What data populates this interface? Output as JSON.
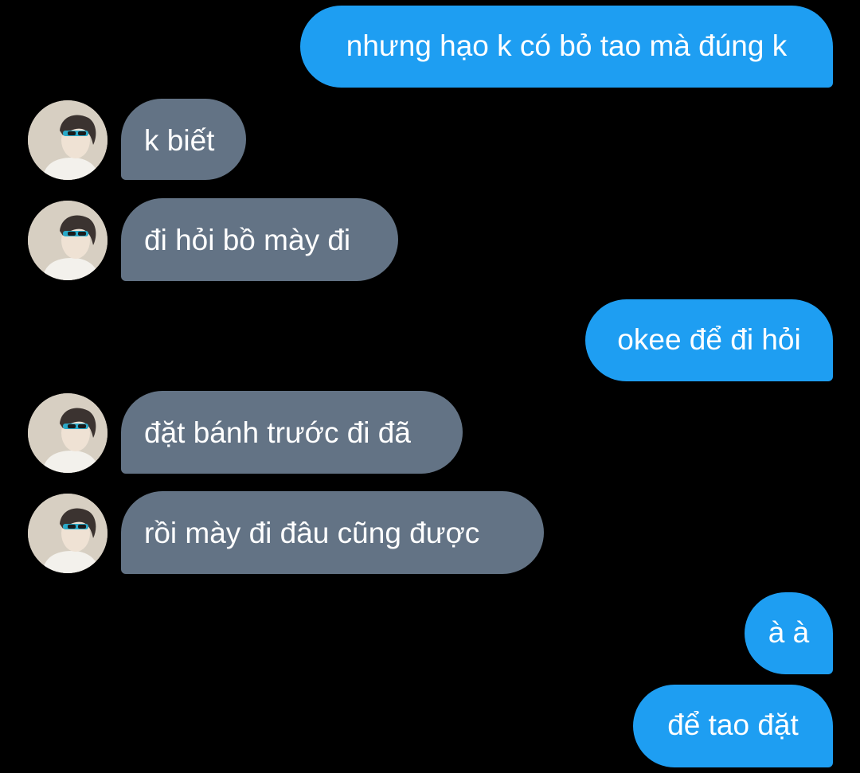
{
  "conversation": {
    "messages": [
      {
        "direction": "outgoing",
        "text": "nhưng hạo k có bỏ tao mà đúng k"
      },
      {
        "direction": "incoming",
        "text": "k biết"
      },
      {
        "direction": "incoming",
        "text": "đi hỏi bồ mày đi"
      },
      {
        "direction": "outgoing",
        "text": "okee để đi hỏi"
      },
      {
        "direction": "incoming",
        "text": "đặt bánh trước đi đã"
      },
      {
        "direction": "incoming",
        "text": "rồi mày đi đâu cũng được"
      },
      {
        "direction": "outgoing",
        "text": "à à"
      },
      {
        "direction": "outgoing",
        "text": "để tao đặt"
      }
    ]
  },
  "colors": {
    "background": "#000000",
    "outgoing_bubble": "#1e9ef2",
    "incoming_bubble": "#637385",
    "text": "#ffffff"
  },
  "icons": {
    "avatar": "contact-avatar"
  }
}
